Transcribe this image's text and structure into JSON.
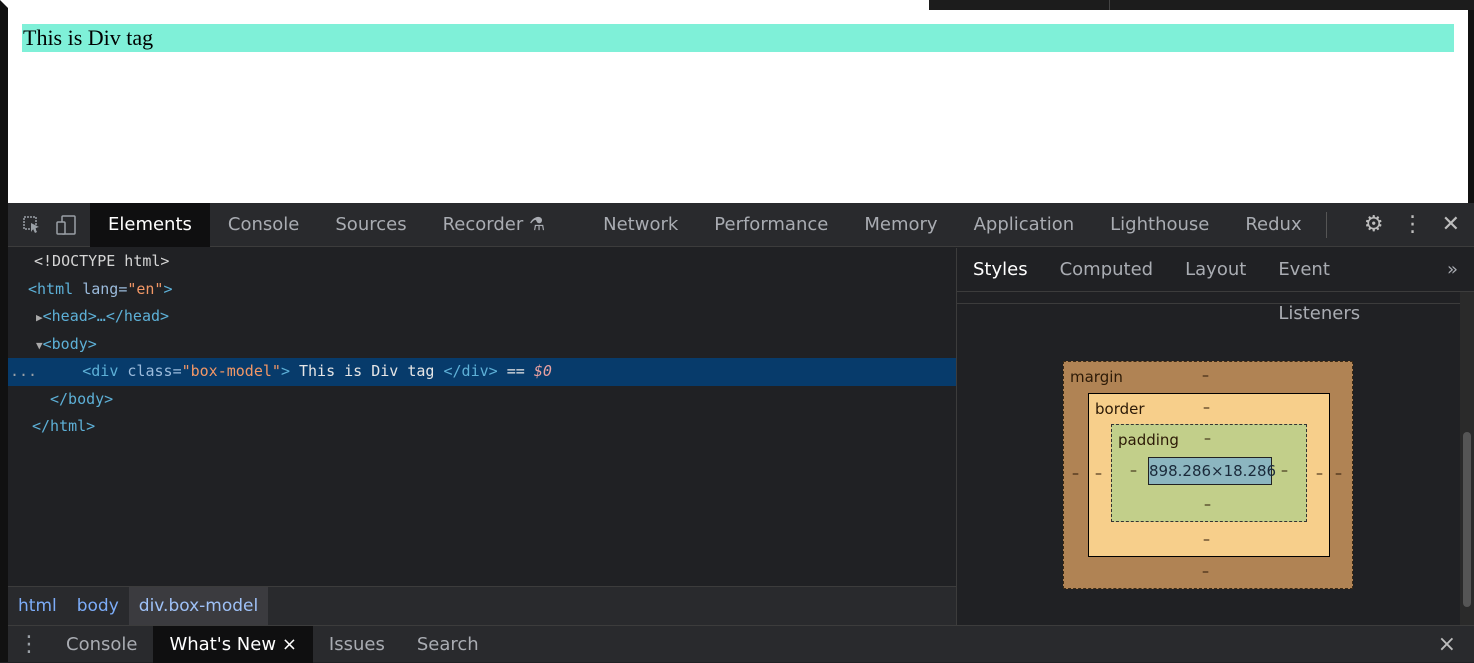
{
  "page": {
    "div_text": "This is Div tag"
  },
  "devtools": {
    "tabs": [
      "Elements",
      "Console",
      "Sources",
      "Recorder",
      "Network",
      "Performance",
      "Memory",
      "Application",
      "Lighthouse",
      "Redux"
    ],
    "active_tab": "Elements",
    "icons": {
      "inspect": "inspect-icon",
      "device": "device-toggle-icon",
      "recorder": "flask-icon",
      "settings": "gear-icon",
      "more": "kebab-icon",
      "close": "close-icon"
    },
    "dom": {
      "doctype": "<!DOCTYPE html>",
      "html_open_tag": "html",
      "html_attr": "lang",
      "html_attr_val": "\"en\"",
      "head": "<head>…</head>",
      "body_open": "<body>",
      "div_tag": "div",
      "div_attr": "class",
      "div_attr_val": "\"box-model\"",
      "div_text": " This is Div tag ",
      "div_close": "</div>",
      "div_eq": " == ",
      "div_dollar": "$0",
      "body_close": "</body>",
      "html_close": "</html>",
      "dots": "..."
    },
    "breadcrumbs": [
      "html",
      "body",
      "div.box-model"
    ],
    "side_tabs": [
      "Styles",
      "Computed",
      "Layout",
      "Event Listeners",
      "»"
    ],
    "box_model": {
      "margin": "margin",
      "border": "border",
      "padding": "padding",
      "content": "898.286×18.286",
      "dash": "–"
    },
    "drawer": {
      "tabs": [
        "Console",
        "What's New",
        "Issues",
        "Search"
      ],
      "active": "What's New",
      "close_tab": "×",
      "close": "×",
      "menu": "⋮"
    }
  }
}
